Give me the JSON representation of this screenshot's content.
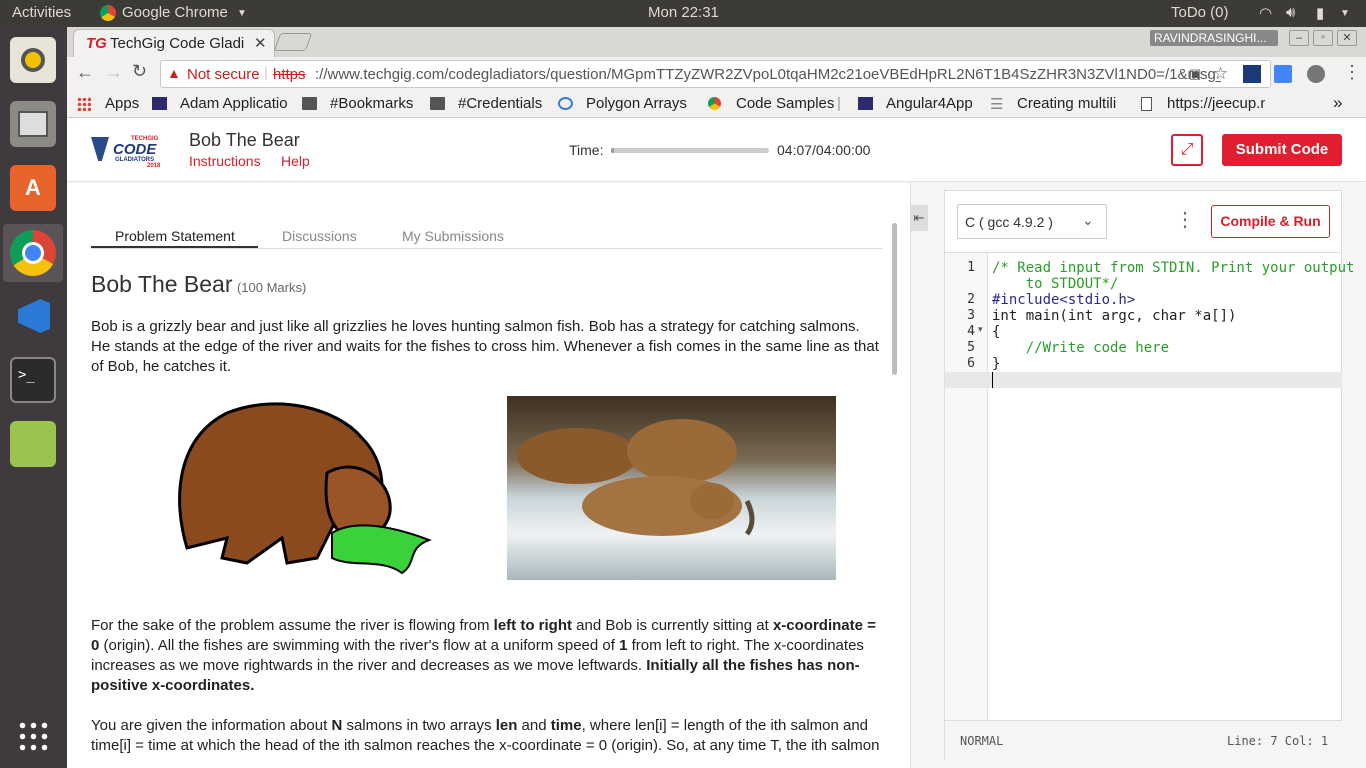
{
  "system": {
    "activities": "Activities",
    "app_name": "Google Chrome",
    "clock": "Mon 22:31",
    "todo": "ToDo (0)"
  },
  "browser": {
    "tab_title": "TechGig Code Gladi",
    "profile": "RAVINDRASINGHI...",
    "security_label": "Not secure",
    "url_scheme": "https",
    "url_rest": "://www.techgig.com/codegladiators/question/MGpmTTZyZWR2ZVpoL0tqaHM2c21oeVBEdHpRL2N6T1B4SzZHR3N3ZVl1ND0=/1&msg_...",
    "bookmarks": [
      {
        "label": "Apps"
      },
      {
        "label": "Adam Applicatio"
      },
      {
        "label": "#Bookmarks"
      },
      {
        "label": "#Credentials"
      },
      {
        "label": "Polygon Arrays"
      },
      {
        "label": "Code Samples"
      },
      {
        "label": "Angular4App"
      },
      {
        "label": "Creating multili"
      },
      {
        "label": "https://jeecup.n"
      }
    ],
    "more": "»"
  },
  "header": {
    "logo_small": "TECHGIG",
    "logo_big": "CODE",
    "logo_sub": "GLADIATORS",
    "logo_year": "2018",
    "title": "Bob The Bear",
    "instructions": "Instructions",
    "help": "Help",
    "time_label": "Time:",
    "time_value": "04:07/04:00:00",
    "time_progress": 0.017,
    "submit": "Submit Code"
  },
  "tabs": [
    "Problem Statement",
    "Discussions",
    "My Submissions"
  ],
  "problem": {
    "title": "Bob The Bear",
    "marks": "(100 Marks)",
    "p1": "Bob is a grizzly bear and just like all grizzlies he loves hunting salmon fish. Bob has a strategy for catching salmons. He stands at the edge of the river and waits for the fishes to cross him. Whenever a fish comes in the same line as that of Bob, he catches it.",
    "p2_a": "For the sake of the problem assume the river is flowing from ",
    "p2_b": "left to right",
    "p2_c": " and Bob is currently sitting at ",
    "p2_d": "x-coordinate = 0",
    "p2_e": " (origin). All the fishes are swimming with the river's flow at a uniform speed of ",
    "p2_f": "1",
    "p2_g": " from left to right. The x-coordinates increases as we move rightwards in the river and decreases as we move leftwards. ",
    "p2_h": "Initially all the fishes has non-positive x-coordinates.",
    "p3_a": "You are given the information about ",
    "p3_b": "N",
    "p3_c": " salmons in two arrays ",
    "p3_d": "len",
    "p3_e": " and ",
    "p3_f": "time",
    "p3_g": ", where len[i] = length of the ith salmon and time[i] = time at which the head of the ith salmon reaches the x-coordinate = 0 (origin). So, at any time T, the ith salmon"
  },
  "editor": {
    "language": "C ( gcc 4.9.2 )",
    "compile": "Compile & Run",
    "line_numbers": [
      "1",
      "",
      "2",
      "3",
      "4",
      "5",
      "6",
      "7"
    ],
    "code_lines": [
      "/* Read input from STDIN. Print your output",
      "    to STDOUT*/",
      "#include<stdio.h>",
      "int main(int argc, char *a[])",
      "{",
      "    //Write code here",
      "}",
      ""
    ],
    "mode": "NORMAL",
    "cursor": "Line: 7 Col: 1"
  },
  "colors": {
    "accent": "#e11d30",
    "link": "#d4202c"
  }
}
